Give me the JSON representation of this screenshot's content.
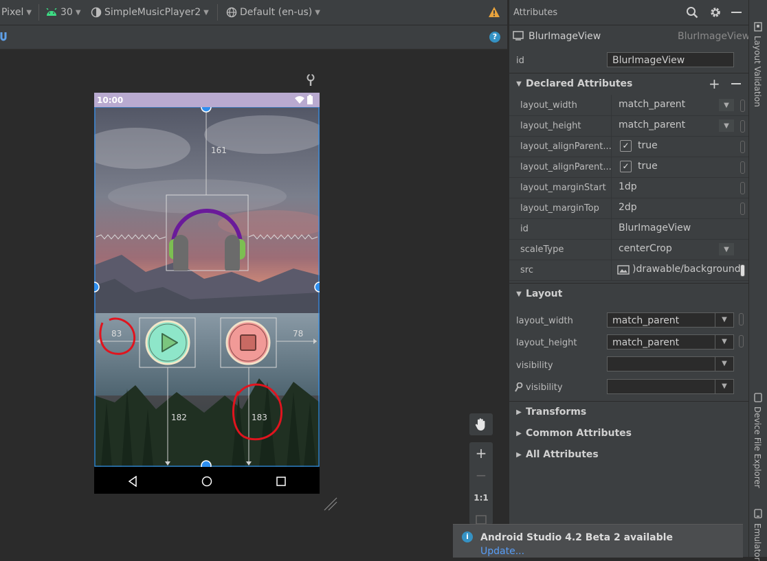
{
  "toolbar": {
    "device": "Pixel",
    "api": "30",
    "theme": "SimpleMusicPlayer2",
    "locale": "Default (en-us)",
    "warning_icon": "warning-icon",
    "help_icon": "help-icon"
  },
  "phone": {
    "time": "10:00",
    "margins": {
      "top": "161",
      "left": "83",
      "right": "78",
      "bottom_left": "182",
      "bottom_right": "183"
    }
  },
  "zoom": {
    "hand_icon": "hand-icon",
    "zoom_in": "+",
    "zoom_out": "−",
    "one_to_one": "1:1"
  },
  "attributes": {
    "title": "Attributes",
    "component_name": "BlurImageView",
    "component_type": "BlurImageView",
    "id_label": "id",
    "id_value": "BlurImageView",
    "declared": {
      "title": "Declared Attributes",
      "rows": [
        {
          "label": "layout_width",
          "value": "match_parent"
        },
        {
          "label": "layout_height",
          "value": "match_parent"
        },
        {
          "label": "layout_alignParent...",
          "value": "true"
        },
        {
          "label": "layout_alignParent...",
          "value": "true"
        },
        {
          "label": "layout_marginStart",
          "value": "1dp"
        },
        {
          "label": "layout_marginTop",
          "value": "2dp"
        },
        {
          "label": "id",
          "value": "BlurImageView"
        },
        {
          "label": "scaleType",
          "value": "centerCrop"
        },
        {
          "label": "src",
          "value": ")drawable/background"
        }
      ]
    },
    "layout": {
      "title": "Layout",
      "rows": [
        {
          "label": "layout_width",
          "value": "match_parent"
        },
        {
          "label": "layout_height",
          "value": "match_parent"
        },
        {
          "label": "visibility",
          "value": ""
        },
        {
          "label": "visibility",
          "value": ""
        }
      ]
    },
    "collapsed": [
      "Transforms",
      "Common Attributes",
      "All Attributes"
    ]
  },
  "side_tabs": {
    "layout_validation": "Layout Validation",
    "device_file_explorer": "Device File Explorer",
    "emulator": "Emulator"
  },
  "notification": {
    "title": "Android Studio 4.2 Beta 2 available",
    "link": "Update..."
  },
  "colors": {
    "accent_blue": "#2f8fef",
    "headphone_band": "#6a1b9a",
    "headphone_ear": "#7cbf52",
    "play_fill": "#8ee6c9",
    "stop_fill": "#f19a97",
    "annotation_red": "#e0141e"
  }
}
